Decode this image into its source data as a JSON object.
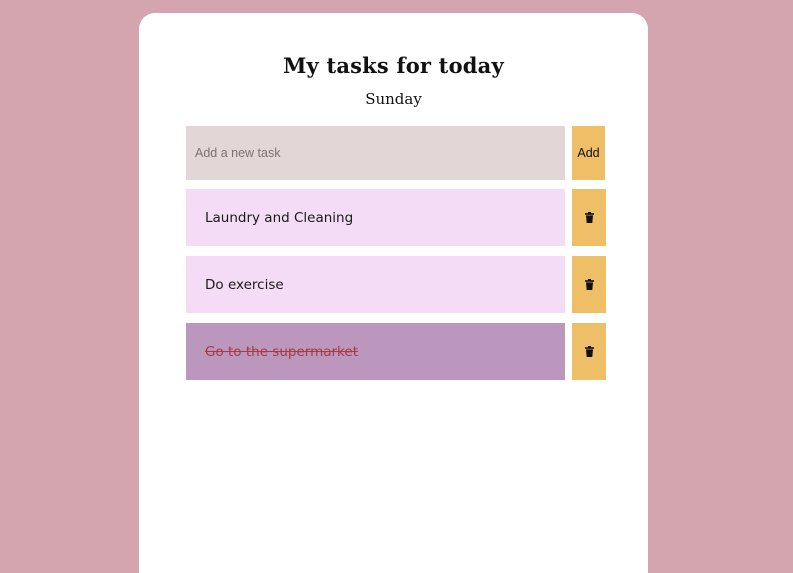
{
  "header": {
    "title": "My tasks for today",
    "day": "Sunday"
  },
  "new_task": {
    "placeholder": "Add a new task",
    "value": "",
    "add_label": "Add"
  },
  "tasks": [
    {
      "text": "Laundry and Cleaning",
      "done": false,
      "delete_icon": "trash-icon"
    },
    {
      "text": "Do exercise",
      "done": false,
      "delete_icon": "trash-icon"
    },
    {
      "text": "Go to the supermarket",
      "done": true,
      "delete_icon": "trash-icon"
    }
  ],
  "colors": {
    "background": "#d4a5ae",
    "card": "#ffffff",
    "input": "#e3d6d6",
    "accent_button": "#eebf66",
    "task": "#f5dcf6",
    "task_done": "#bc97bd",
    "task_done_text": "#a73a45"
  }
}
